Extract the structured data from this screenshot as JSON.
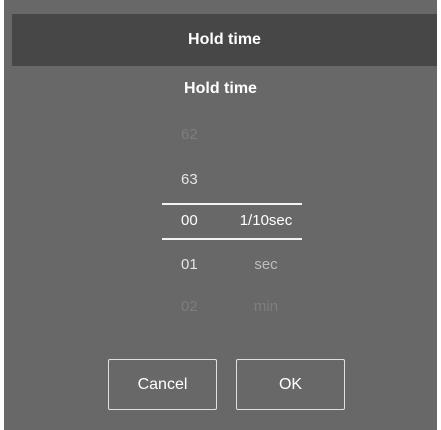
{
  "dialog": {
    "title": "Hold time",
    "subtitle": "Hold time"
  },
  "picker": {
    "rows": [
      {
        "number": "62",
        "unit": "",
        "state": "far"
      },
      {
        "number": "63",
        "unit": "",
        "state": "near"
      },
      {
        "number": "00",
        "unit": "1/10sec",
        "state": "selected"
      },
      {
        "number": "01",
        "unit": "sec",
        "state": "near"
      },
      {
        "number": "02",
        "unit": "min",
        "state": "far"
      }
    ]
  },
  "buttons": {
    "cancel_label": "Cancel",
    "ok_label": "OK"
  },
  "colors": {
    "dialog_background": "#686868",
    "titlebar_background": "#474747",
    "text": "#ffffff"
  }
}
